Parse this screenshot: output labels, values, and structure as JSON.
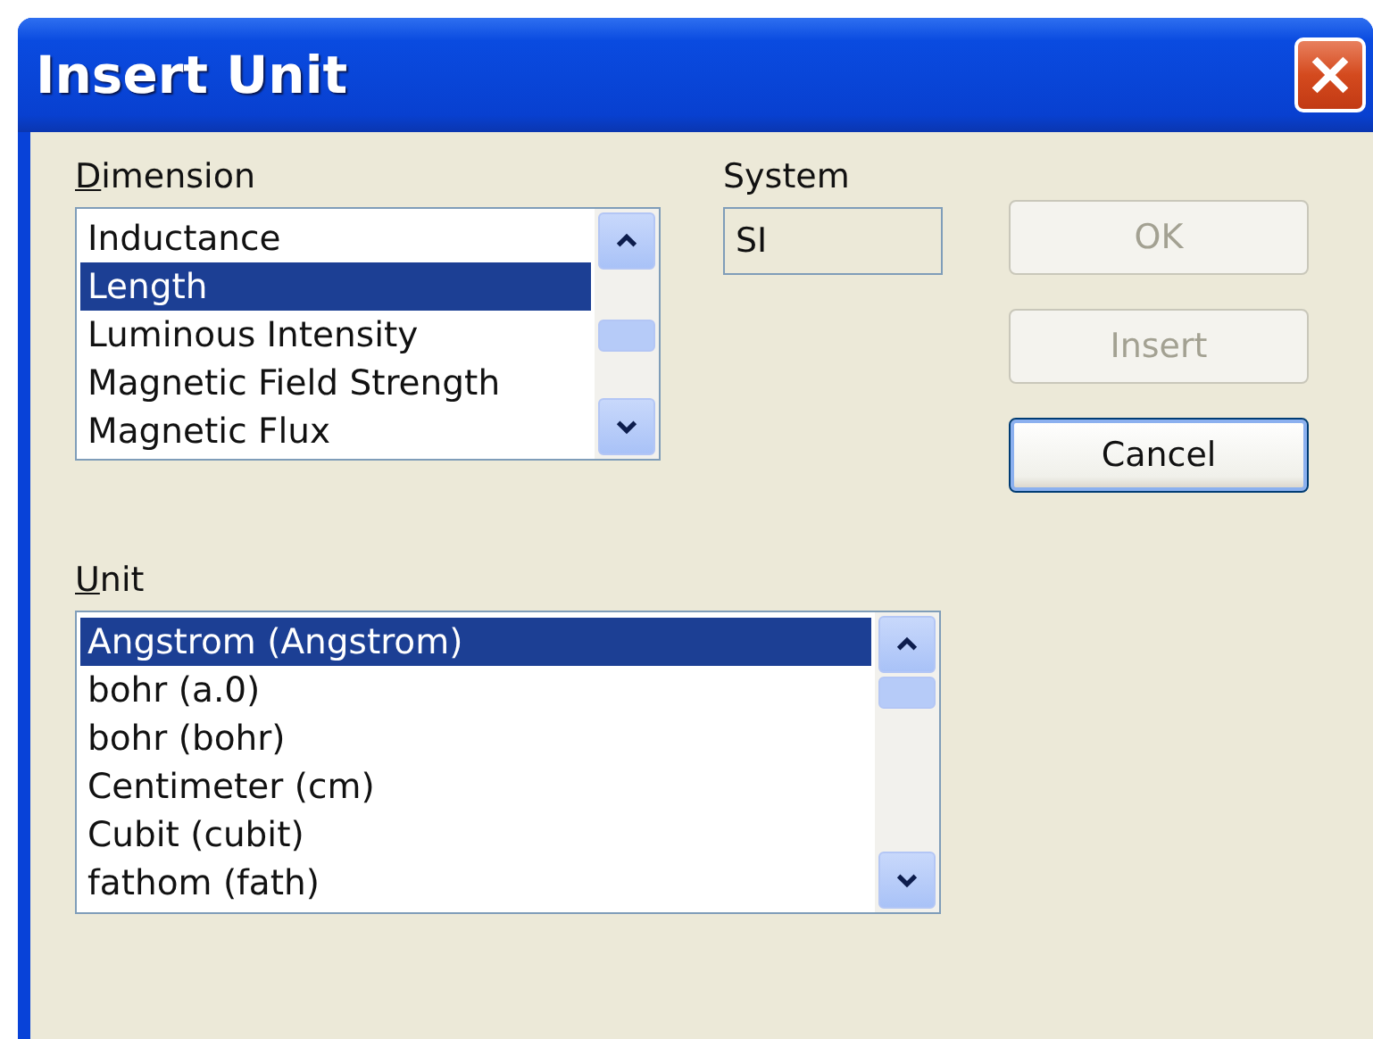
{
  "window": {
    "title": "Insert Unit"
  },
  "dimension": {
    "label": "Dimension",
    "items": [
      {
        "label": "Inductance",
        "selected": false
      },
      {
        "label": "Length",
        "selected": true
      },
      {
        "label": "Luminous Intensity",
        "selected": false
      },
      {
        "label": "Magnetic Field Strength",
        "selected": false
      },
      {
        "label": "Magnetic Flux",
        "selected": false
      }
    ]
  },
  "system": {
    "label": "System",
    "value": "SI"
  },
  "buttons": [
    {
      "label": "OK",
      "disabled": true,
      "focused": false
    },
    {
      "label": "Insert",
      "disabled": true,
      "focused": false
    },
    {
      "label": "Cancel",
      "disabled": false,
      "focused": true
    }
  ],
  "unit": {
    "label": "Unit",
    "items": [
      {
        "label": "Angstrom (Angstrom)",
        "selected": true
      },
      {
        "label": "bohr (a.0)",
        "selected": false
      },
      {
        "label": "bohr (bohr)",
        "selected": false
      },
      {
        "label": "Centimeter (cm)",
        "selected": false
      },
      {
        "label": "Cubit (cubit)",
        "selected": false
      },
      {
        "label": "fathom (fath)",
        "selected": false
      }
    ]
  }
}
